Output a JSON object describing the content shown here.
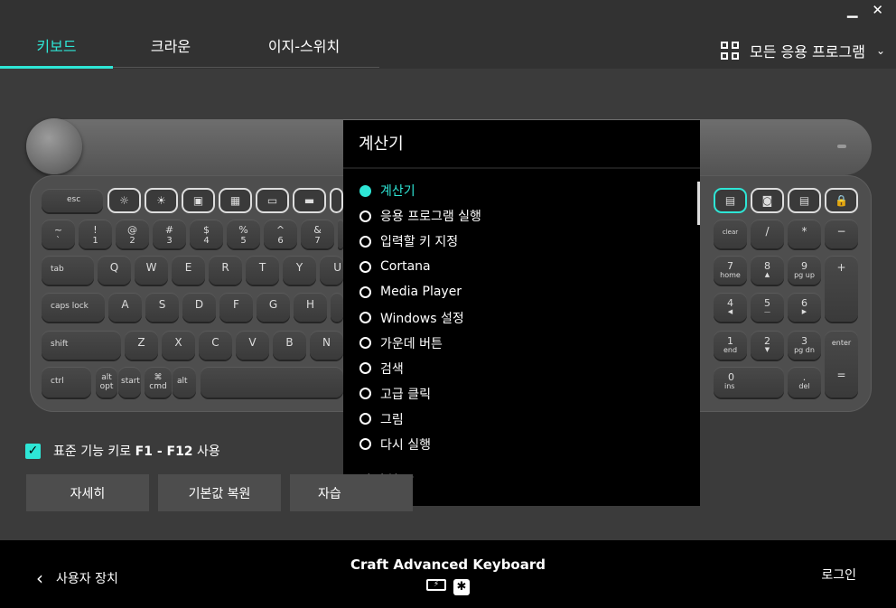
{
  "window": {
    "minimize": "▁",
    "close": "✕"
  },
  "tabs": [
    {
      "label": "키보드",
      "active": true
    },
    {
      "label": "크라운",
      "active": false
    },
    {
      "label": "이지-스위치",
      "active": false
    }
  ],
  "app_selector": {
    "label": "모든 응용 프로그램",
    "icon": "grid-icon"
  },
  "accent_color": "#2ee6d6",
  "keyboard": {
    "fn_row": [
      "esc"
    ],
    "row1": [
      [
        "~",
        "`"
      ],
      [
        "!",
        "1"
      ],
      [
        "@",
        "2"
      ],
      [
        "#",
        "3"
      ],
      [
        "$",
        "4"
      ],
      [
        "%",
        "5"
      ],
      [
        "^",
        "6"
      ],
      [
        "&",
        "7"
      ]
    ],
    "row2": [
      "tab",
      "Q",
      "W",
      "E",
      "R",
      "T",
      "Y",
      "U"
    ],
    "row3": [
      "caps lock",
      "A",
      "S",
      "D",
      "F",
      "G",
      "H"
    ],
    "row4": [
      "shift",
      "Z",
      "X",
      "C",
      "V",
      "B",
      "N"
    ],
    "row5": [
      "ctrl",
      [
        "alt",
        "opt"
      ],
      "start",
      [
        "⌘",
        "cmd"
      ],
      "alt"
    ],
    "numpad": {
      "clear": "clear",
      "slash": "/",
      "star": "*",
      "minus": "−",
      "plus": "+",
      "enter": "enter",
      "eq": "=",
      "n7": [
        "7",
        "home"
      ],
      "n8": [
        "8",
        "▲"
      ],
      "n9": [
        "9",
        "pg up"
      ],
      "n4": [
        "4",
        "◀"
      ],
      "n5": [
        "5",
        "—"
      ],
      "n6": [
        "6",
        "▶"
      ],
      "n1": [
        "1",
        "end"
      ],
      "n2": [
        "2",
        "▼"
      ],
      "n3": [
        "3",
        "pg dn"
      ],
      "n0": [
        "0",
        "ins"
      ],
      "dot": [
        ".",
        "del"
      ]
    }
  },
  "dropdown": {
    "title": "계산기",
    "items": [
      {
        "label": "계산기",
        "selected": true
      },
      {
        "label": "응용 프로그램 실행",
        "selected": false
      },
      {
        "label": "입력할 키 지정",
        "selected": false
      },
      {
        "label": "Cortana",
        "selected": false
      },
      {
        "label": "Media Player",
        "selected": false
      },
      {
        "label": "Windows 설정",
        "selected": false
      },
      {
        "label": "가운데 버튼",
        "selected": false
      },
      {
        "label": "검색",
        "selected": false
      },
      {
        "label": "고급 클릭",
        "selected": false
      },
      {
        "label": "그림",
        "selected": false
      },
      {
        "label": "다시 실행",
        "selected": false
      }
    ],
    "collapse_label": "간단히"
  },
  "options": {
    "fkey_label_a": "표준 기능 키로 ",
    "fkey_label_b": "F1 - F12",
    "fkey_label_c": " 사용",
    "fkey_checked": true
  },
  "buttons": {
    "details": "자세히",
    "restore": "기본값 복원",
    "learn": "자습"
  },
  "footer": {
    "back_label": "사용자 장치",
    "device_name": "Craft Advanced Keyboard",
    "login": "로그인"
  }
}
